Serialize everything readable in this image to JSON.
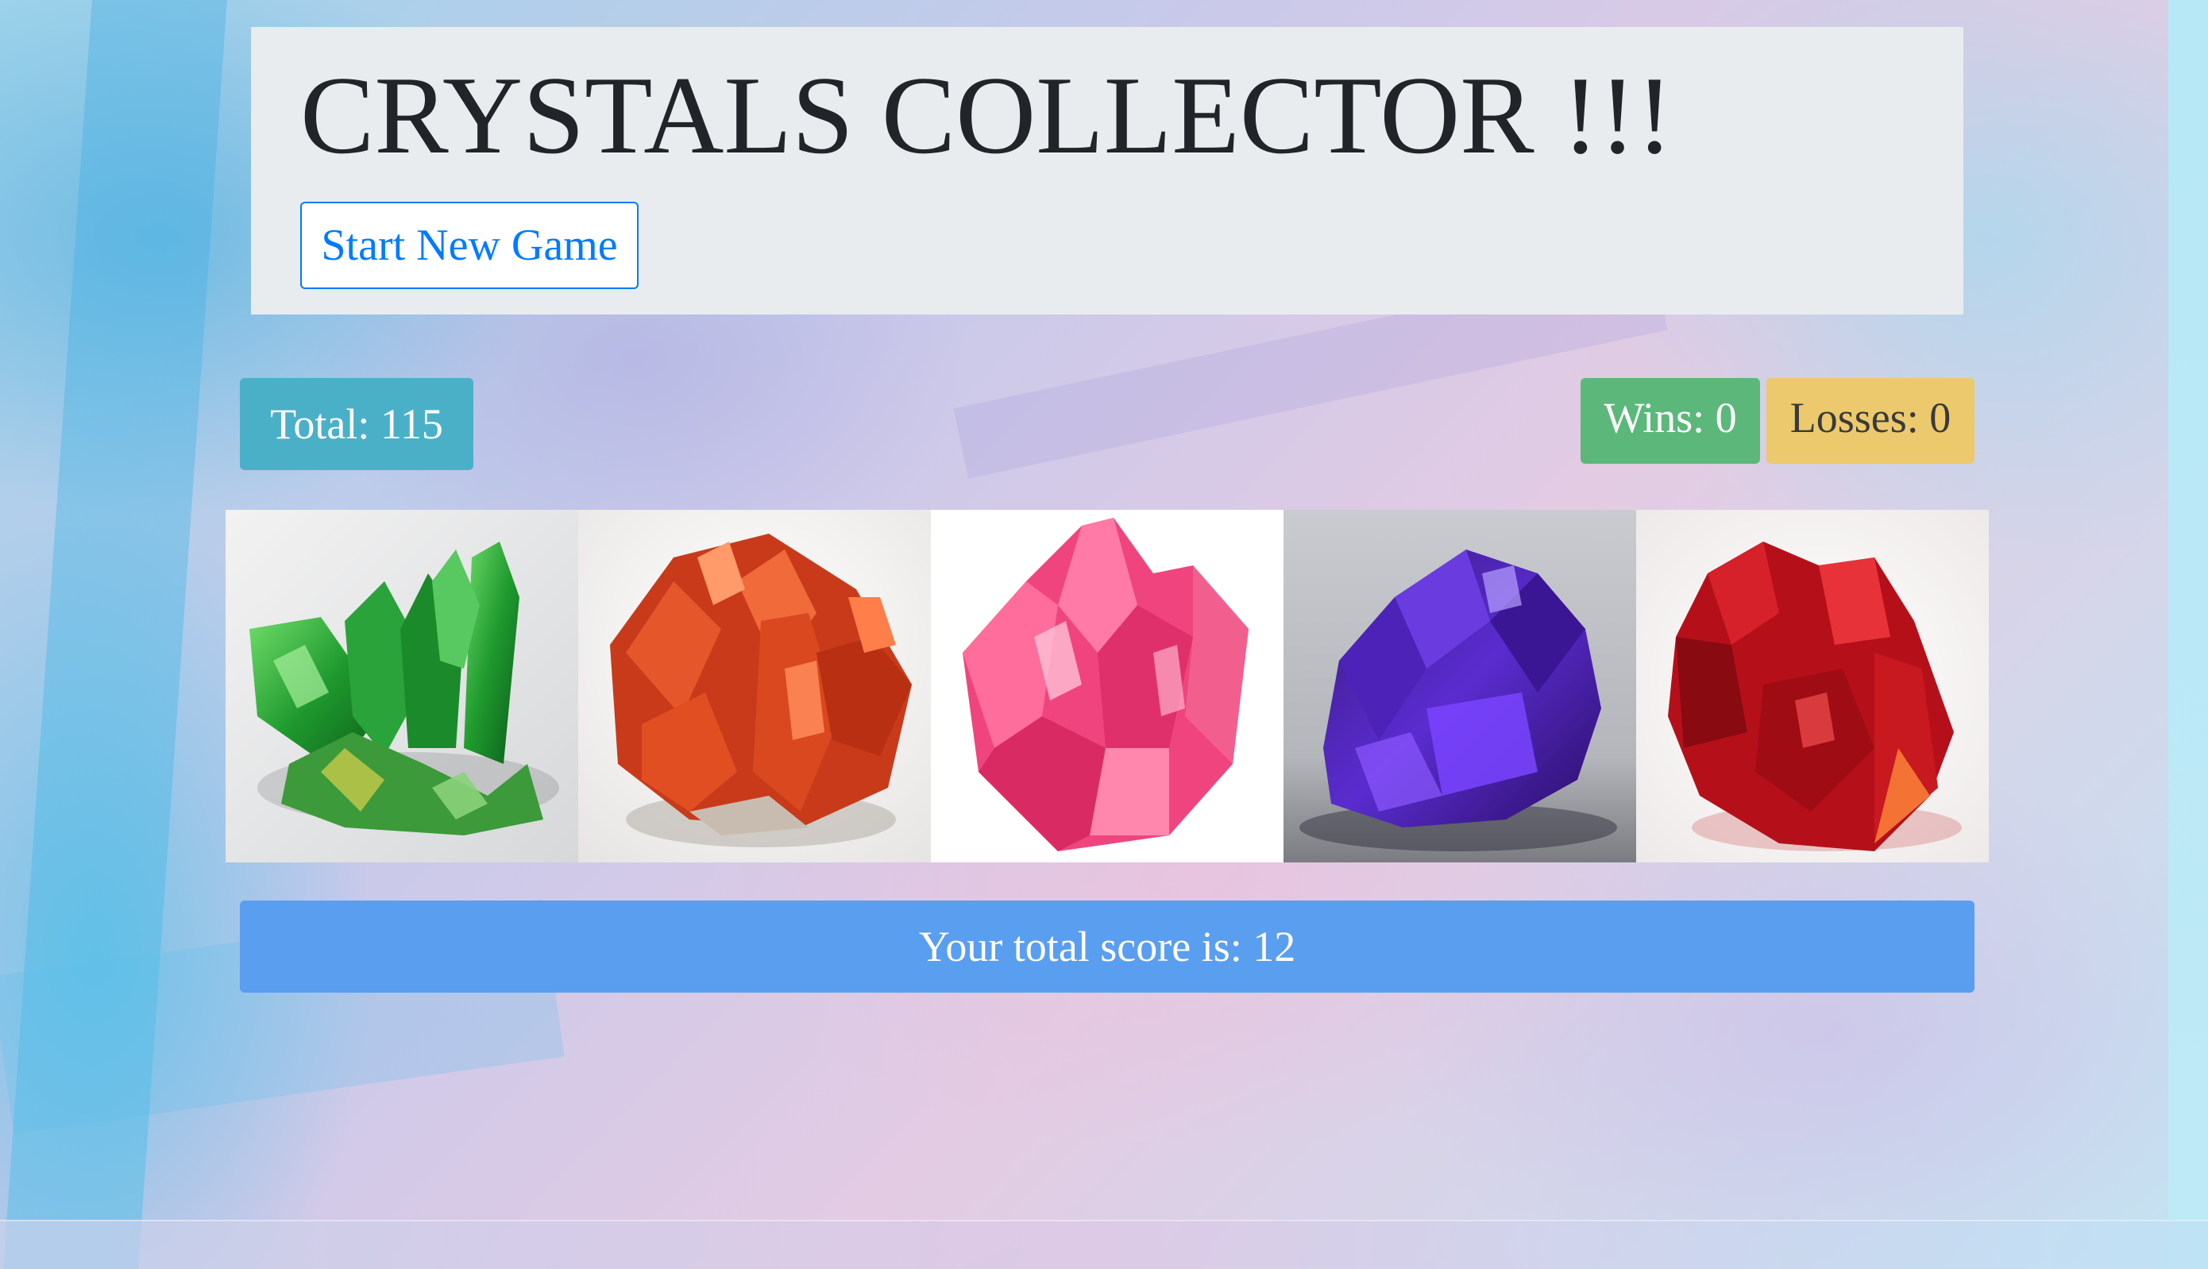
{
  "header": {
    "title": "CRYSTALS COLLECTOR !!!",
    "start_button_label": "Start New Game"
  },
  "scoreboard": {
    "total_label": "Total: 115",
    "wins_label": "Wins: 0",
    "losses_label": "Losses: 0"
  },
  "crystals": [
    {
      "name": "green-crystal",
      "color": "#2e9e3a"
    },
    {
      "name": "orange-crystal",
      "color": "#d9481e"
    },
    {
      "name": "pink-crystal",
      "color": "#f0447e"
    },
    {
      "name": "purple-crystal",
      "color": "#4b1fa8"
    },
    {
      "name": "red-crystal",
      "color": "#b5101a"
    }
  ],
  "score": {
    "text": "Your total score is: 12"
  },
  "colors": {
    "jumbotron_bg": "#e9ecef",
    "primary": "#007bff",
    "info": "#4ab0c8",
    "success": "#5cb87a",
    "warning": "#ecc96c",
    "score_bar": "#5a9ef0"
  }
}
